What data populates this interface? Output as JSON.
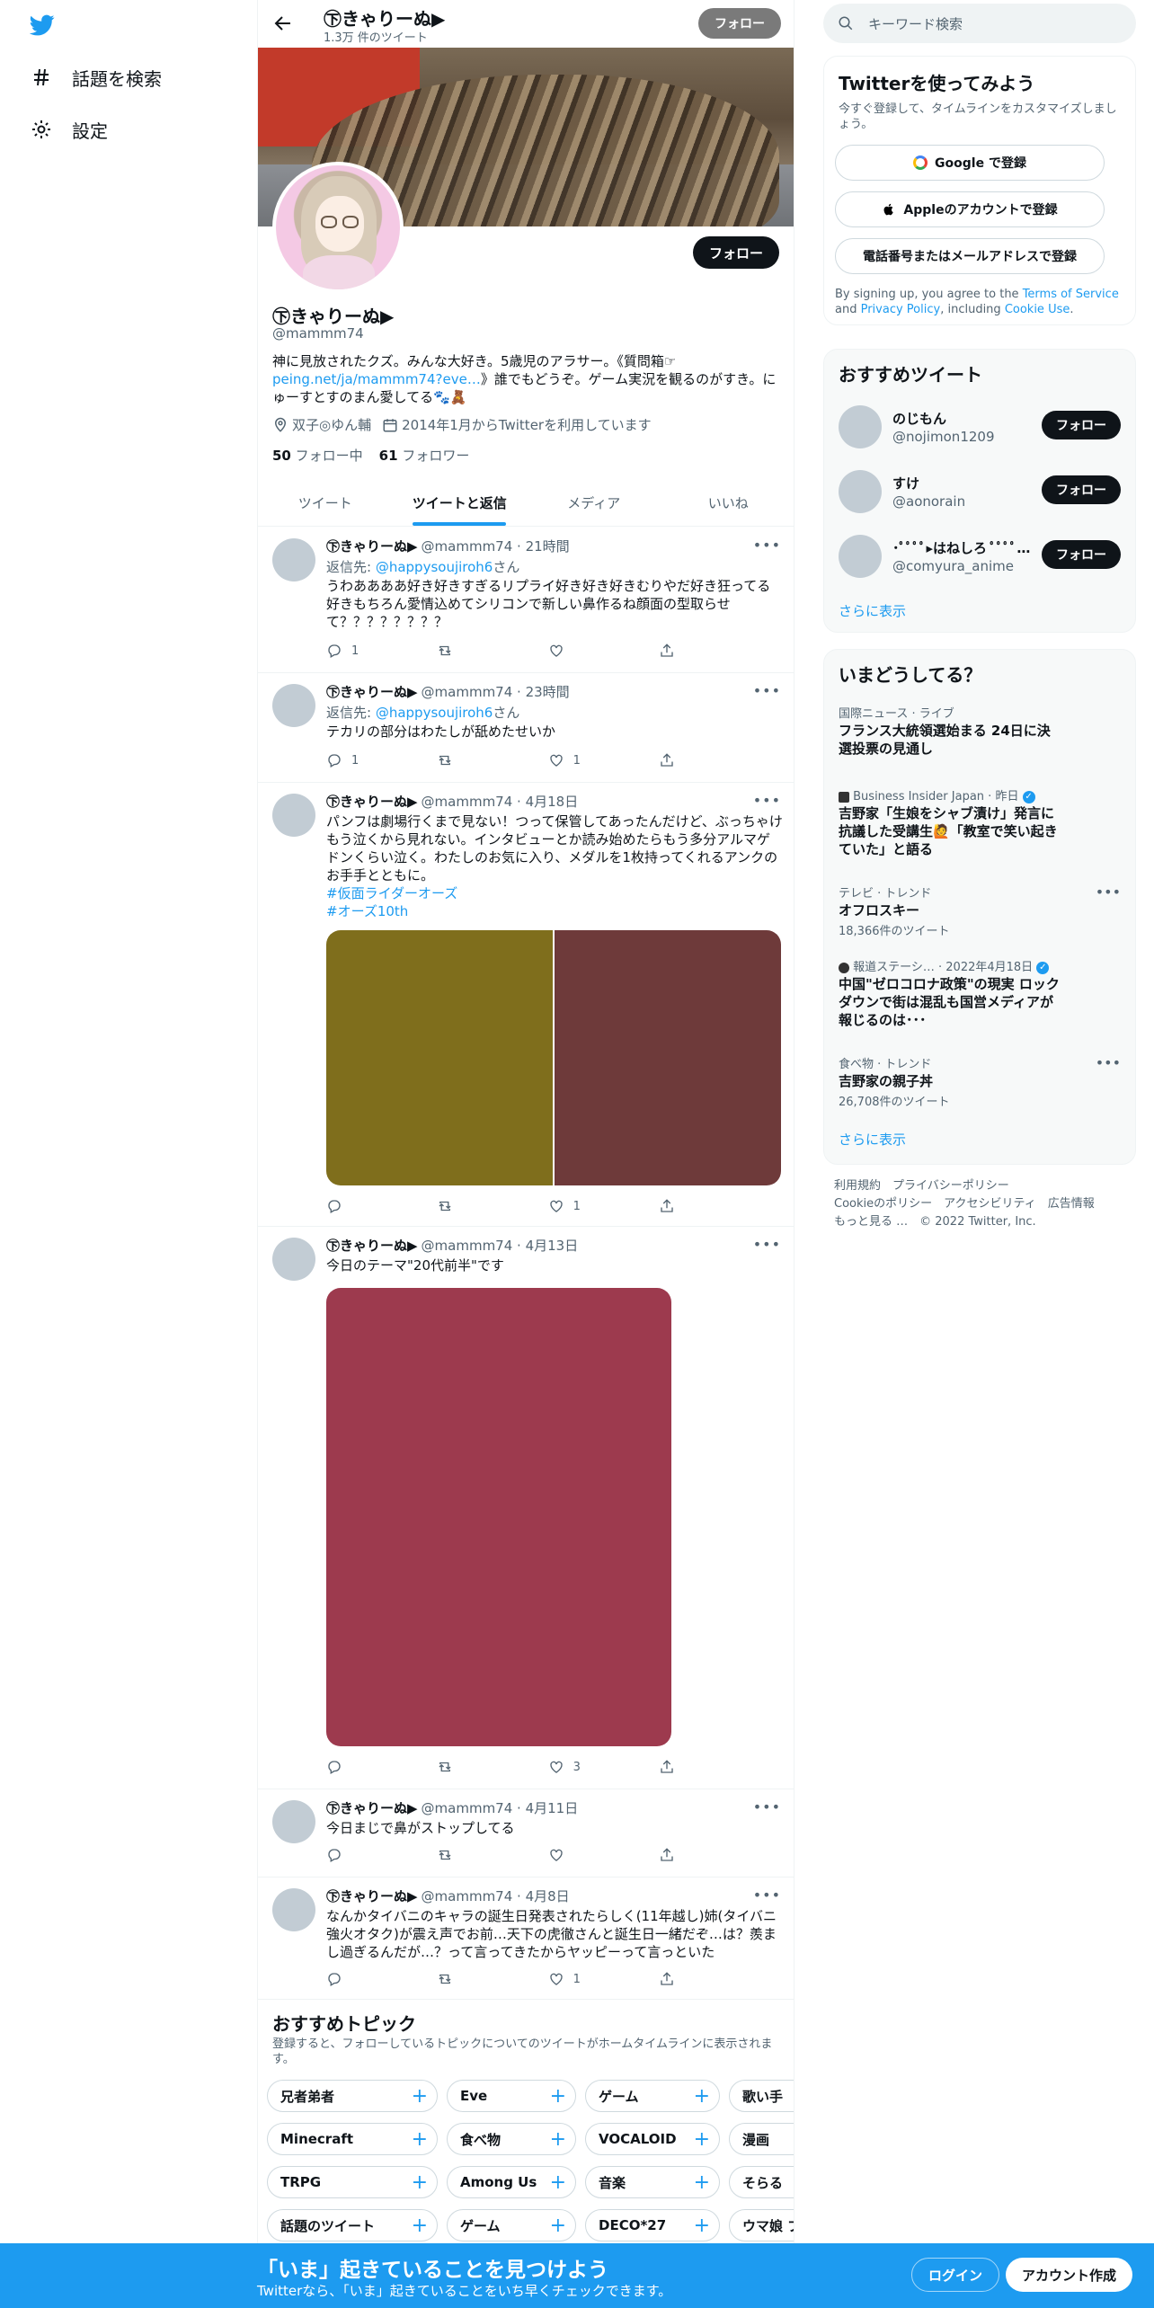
{
  "nav": {
    "explore_label": "話題を検索",
    "settings_label": "設定"
  },
  "profile": {
    "name": "㊦きゃりーぬ▶",
    "tweet_count": "1.3万 件のツイート",
    "follow_label": "フォロー",
    "handle": "@mammm74",
    "bio_part1": "神に見放されたクズ。みんな大好き。5歳児のアラサー。《質問箱☞",
    "bio_link": "peing.net/ja/mammm74?eve…",
    "bio_part2": "》誰でもどうぞ。ゲーム実況を観るのがすき。にゅーすとすのまん愛してる🐾🧸",
    "location": "双子◎ゆん輔",
    "joined": "2014年1月からTwitterを利用しています",
    "following_count": "50",
    "following_label": "フォロー中",
    "followers_count": "61",
    "followers_label": "フォロワー"
  },
  "tabs": [
    "ツイート",
    "ツイートと返信",
    "メディア",
    "いいね"
  ],
  "tweets": [
    {
      "name": "㊦きゃりーぬ▶",
      "meta": "@mammm74 · 21時間",
      "reply_prefix": "返信先: ",
      "reply_to": "@happysoujiroh6",
      "reply_suffix": "さん",
      "text": "うわああああ好き好きすぎるリプライ好き好き好きむりやだ好き狂ってる好きもちろん愛情込めてシリコンで新しい鼻作るね顔面の型取らせて？？？？？？？？",
      "replies": "1",
      "retweets": "",
      "likes": ""
    },
    {
      "name": "㊦きゃりーぬ▶",
      "meta": "@mammm74 · 23時間",
      "reply_prefix": "返信先: ",
      "reply_to": "@happysoujiroh6",
      "reply_suffix": "さん",
      "text": "テカリの部分はわたしが舐めたせいか",
      "replies": "1",
      "retweets": "",
      "likes": "1"
    },
    {
      "name": "㊦きゃりーぬ▶",
      "meta": "@mammm74 · 4月18日",
      "text": "パンフは劇場行くまで見ない！つって保管してあったんだけど、ぶっちゃけもう泣くから見れない。インタビューとか読み始めたらもう多分アルマゲドンくらい泣く。わたしのお気に入り、メダルを1枚持ってくれるアンクのお手手とともに。",
      "hashtag1": "#仮面ライダーオーズ",
      "hashtag2": "#オーズ10th",
      "replies": "",
      "retweets": "",
      "likes": "1",
      "media_colors": [
        "#7f6e1c",
        "#6e3a3a"
      ]
    },
    {
      "name": "㊦きゃりーぬ▶",
      "meta": "@mammm74 · 4月13日",
      "text": "今日のテーマ\"20代前半\"です",
      "replies": "",
      "retweets": "",
      "likes": "3",
      "media_colors": [
        "#9d3a4e"
      ]
    },
    {
      "name": "㊦きゃりーぬ▶",
      "meta": "@mammm74 · 4月11日",
      "text": "今日まじで鼻がストップしてる",
      "replies": "",
      "retweets": "",
      "likes": ""
    },
    {
      "name": "㊦きゃりーぬ▶",
      "meta": "@mammm74 · 4月8日",
      "text": "なんかタイバニのキャラの誕生日発表されたらしく(11年越し)姉(タイバニ強火オタク)が震え声でお前…天下の虎徹さんと誕生日一緒だぞ…は？羨まし過ぎるんだが…？って言ってきたからヤッピーって言っといた",
      "replies": "",
      "retweets": "",
      "likes": "1"
    }
  ],
  "topics": {
    "title": "おすすめトピック",
    "subtitle": "登録すると、フォローしているトピックについてのツイートがホームタイムラインに表示されます。",
    "chips": [
      [
        "兄者弟者",
        "Eve",
        "ゲーム",
        "歌い手"
      ],
      [
        "Minecraft",
        "食べ物",
        "VOCALOID",
        "漫画"
      ],
      [
        "TRPG",
        "Among Us",
        "音楽",
        "そらる"
      ],
      [
        "話題のツイート",
        "ゲーム",
        "DECO*27",
        "ウマ娘 プ"
      ]
    ]
  },
  "right": {
    "search_placeholder": "キーワード検索",
    "signup_title": "Twitterを使ってみよう",
    "signup_sub": "今すぐ登録して、タイムラインをカスタマイズしましょう。",
    "google_label": "Google で登録",
    "apple_label": "Appleのアカウントで登録",
    "phone_label": "電話番号またはメールアドレスで登録",
    "terms_prefix": "By signing up, you agree to the ",
    "terms_tos": "Terms of Service",
    "terms_and": " and ",
    "terms_privacy": "Privacy Policy",
    "terms_incl": ", including ",
    "terms_cookie": "Cookie Use",
    "terms_end": ".",
    "who_title": "おすすめツイート",
    "who": [
      {
        "name": "のじもん",
        "handle": "@nojimon1209",
        "button": "フォロー"
      },
      {
        "name": "すけ",
        "handle": "@aonorain",
        "button": "フォロー"
      },
      {
        "name": "･ﾟﾟﾟﾟ▸はねしろ ﾟﾟﾟﾟ…",
        "handle": "@comyura_anime",
        "button": "フォロー"
      }
    ],
    "show_more": "さらに表示",
    "trends_title": "いまどうしてる？",
    "trends": [
      {
        "context": "国際ニュース · ライブ",
        "title": "フランス大統領選始まる 24日に決選投票の見通し"
      },
      {
        "context": "Business Insider Japan · 昨日",
        "title": "吉野家「生娘をシャブ漬け」発言に抗議した受講生🙋「教室で笑い起きていた」と語る"
      },
      {
        "context": "テレビ · トレンド",
        "title": "オフロスキー",
        "count": "18,366件のツイート"
      },
      {
        "context": "報道ステーシ… · 2022年4月18日",
        "title": "中国\"ゼロコロナ政策\"の現実 ロックダウンで街は混乱も国営メディアが報じるのは･･･"
      },
      {
        "context": "食べ物 · トレンド",
        "title": "吉野家の親子丼",
        "count": "26,708件のツイート"
      }
    ],
    "footer_line1": "利用規約　プライバシーポリシー",
    "footer_line2": "Cookieのポリシー　アクセシビリティ　広告情報",
    "footer_line3": "もっと見る …　© 2022 Twitter, Inc."
  },
  "bottom": {
    "title": "「いま」起きていることを見つけよう",
    "subtitle": "Twitterなら、「いま」起きていることをいち早くチェックできます。",
    "login": "ログイン",
    "signup": "アカウント作成"
  },
  "colors": {
    "accent": "#1d9bf0",
    "text": "#0f1419",
    "muted": "#536471"
  }
}
